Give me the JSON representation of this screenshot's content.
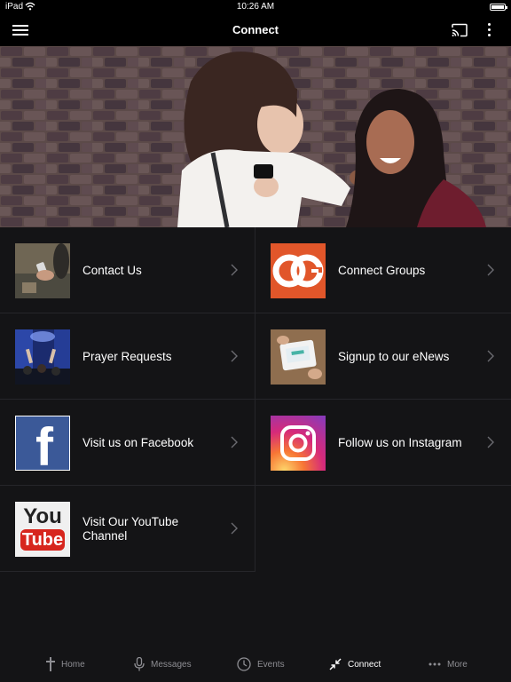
{
  "status": {
    "carrier": "iPad",
    "time": "10:26 AM"
  },
  "header": {
    "title": "Connect"
  },
  "tiles": [
    {
      "label": "Contact Us",
      "thumb": "phone-photo"
    },
    {
      "label": "Connect Groups",
      "thumb": "connect-groups-logo"
    },
    {
      "label": "Prayer Requests",
      "thumb": "worship-photo"
    },
    {
      "label": "Signup to our eNews",
      "thumb": "tablet-photo"
    },
    {
      "label": "Visit us on Facebook",
      "thumb": "facebook-logo"
    },
    {
      "label": "Follow us on Instagram",
      "thumb": "instagram-logo"
    },
    {
      "label": "Visit Our YouTube Channel",
      "thumb": "youtube-logo"
    }
  ],
  "logos": {
    "facebook": "f",
    "youtube_top": "You",
    "youtube_bottom": "Tube"
  },
  "tabs": [
    {
      "label": "Home",
      "icon": "cross-icon"
    },
    {
      "label": "Messages",
      "icon": "microphone-icon"
    },
    {
      "label": "Events",
      "icon": "clock-icon"
    },
    {
      "label": "Connect",
      "icon": "connect-arrows-icon",
      "active": true
    },
    {
      "label": "More",
      "icon": "more-dots-icon"
    }
  ],
  "colors": {
    "background": "#141416",
    "bar": "#000000",
    "active_tab": "#ffffff",
    "inactive_tab": "#8e8e93",
    "facebook": "#3b5998"
  }
}
